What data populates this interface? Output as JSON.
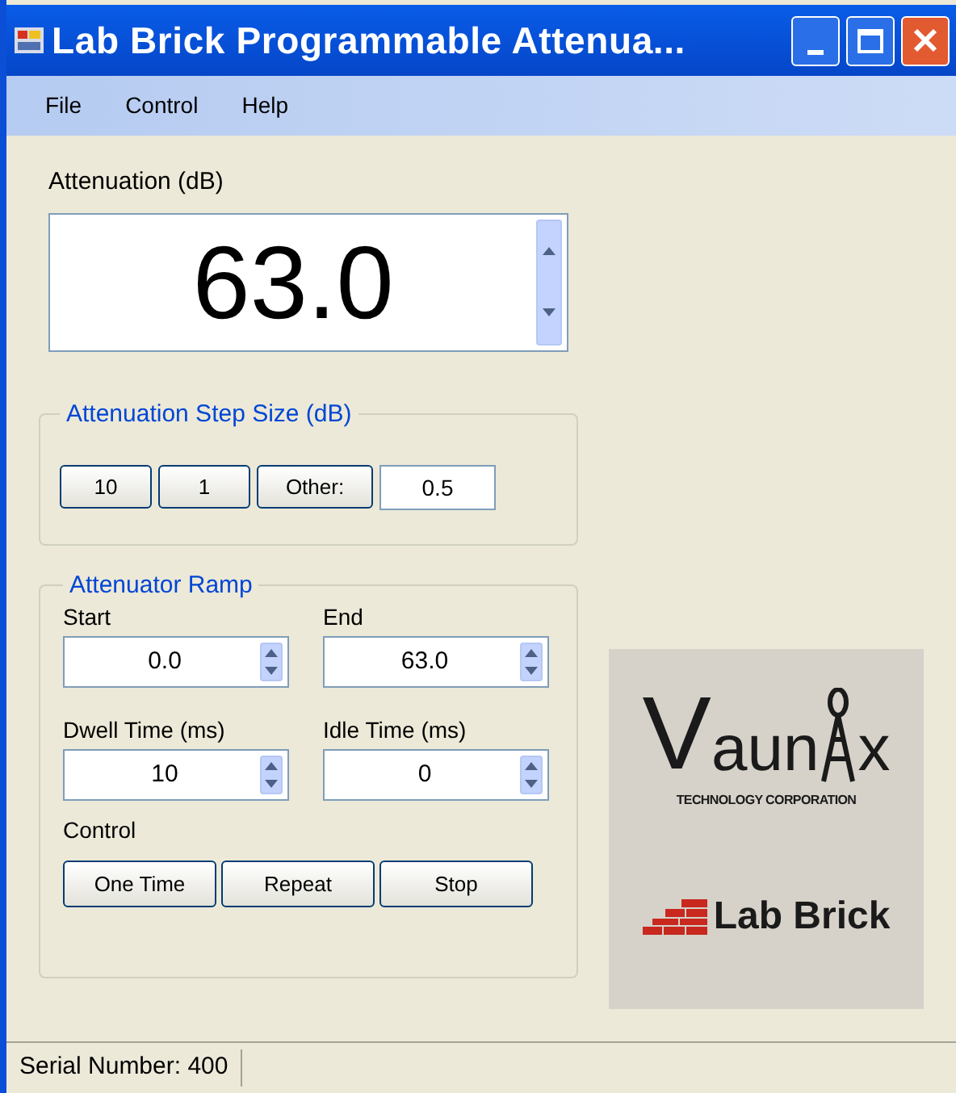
{
  "window": {
    "title": "Lab Brick Programmable Attenua..."
  },
  "menu": [
    "File",
    "Control",
    "Help"
  ],
  "attenuation": {
    "label": "Attenuation (dB)",
    "value": "63.0"
  },
  "step_size": {
    "title": "Attenuation Step Size (dB)",
    "buttons": [
      "10",
      "1",
      "Other:"
    ],
    "other_value": "0.5"
  },
  "ramp": {
    "title": "Attenuator Ramp",
    "fields": [
      {
        "label": "Start",
        "value": "0.0"
      },
      {
        "label": "End",
        "value": "63.0"
      },
      {
        "label": "Dwell Time (ms)",
        "value": "10"
      },
      {
        "label": "Idle Time (ms)",
        "value": "0"
      }
    ],
    "control_label": "Control",
    "buttons": [
      "One Time",
      "Repeat",
      "Stop"
    ]
  },
  "logo": {
    "lead": "V",
    "middle": "aun",
    "tail": "x",
    "tagline": "TECHNOLOGY CORPORATION",
    "product": "Lab Brick"
  },
  "status_bar": {
    "serial": "Serial Number: 400"
  }
}
